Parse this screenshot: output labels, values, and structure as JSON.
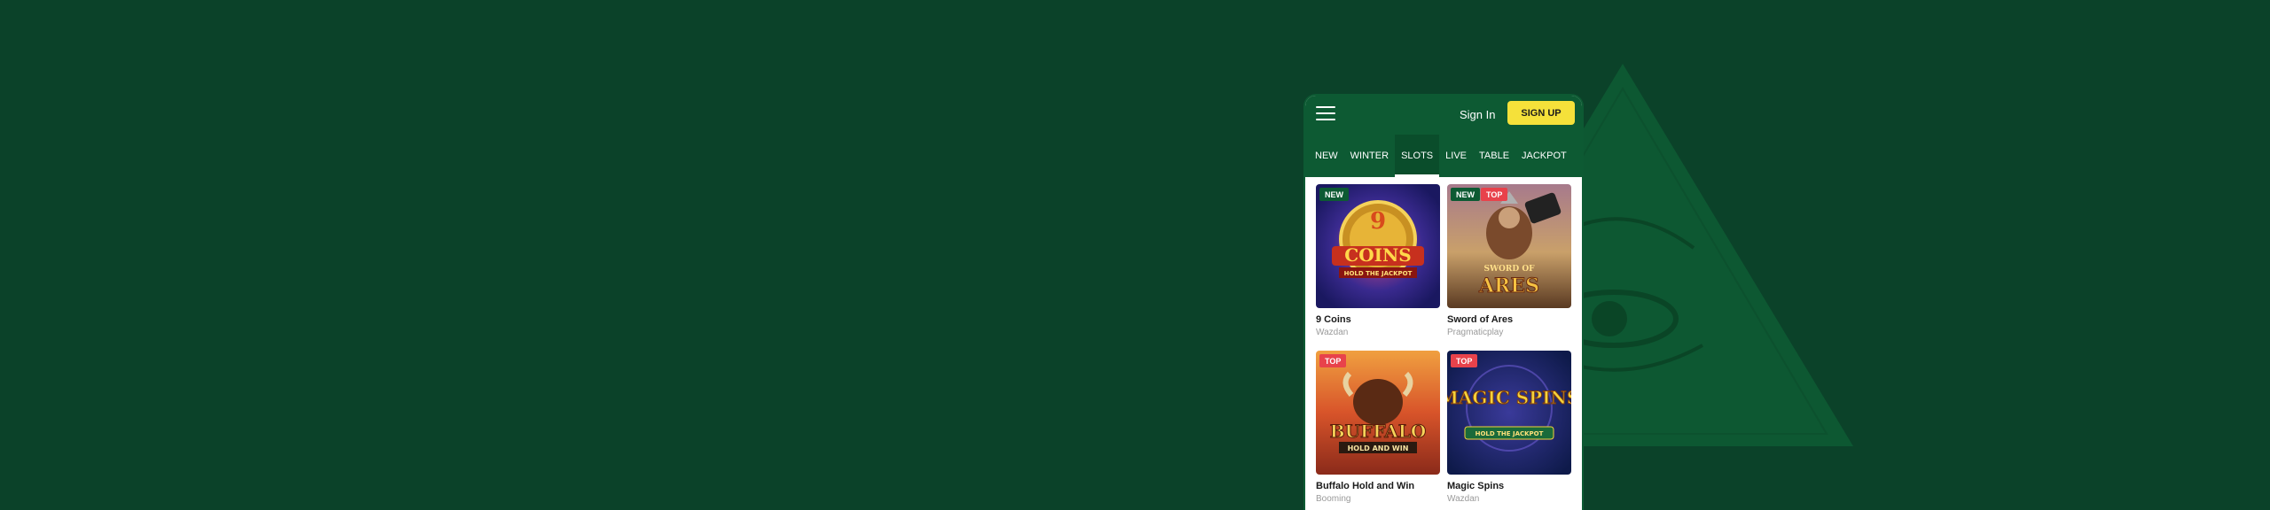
{
  "header": {
    "sign_in_label": "Sign In",
    "sign_up_label": "SIGN UP"
  },
  "tabs": [
    {
      "label": "NEW",
      "active": false
    },
    {
      "label": "WINTER",
      "active": false
    },
    {
      "label": "SLOTS",
      "active": true
    },
    {
      "label": "LIVE",
      "active": false
    },
    {
      "label": "TABLE",
      "active": false
    },
    {
      "label": "JACKPOT",
      "active": false
    }
  ],
  "games": [
    {
      "title": "9 Coins",
      "provider": "Wazdan",
      "badges": [
        "NEW"
      ],
      "art_title": "COINS",
      "art_subtitle": "HOLD THE JACKPOT"
    },
    {
      "title": "Sword of Ares",
      "provider": "Pragmaticplay",
      "badges": [
        "NEW",
        "TOP"
      ],
      "art_title": "ARES",
      "art_subtitle": "SWORD OF"
    },
    {
      "title": "Buffalo Hold and Win",
      "provider": "Booming",
      "badges": [
        "TOP"
      ],
      "art_title": "BUFFALO",
      "art_subtitle": "HOLD AND WIN"
    },
    {
      "title": "Magic Spins",
      "provider": "Wazdan",
      "badges": [
        "TOP"
      ],
      "art_title": "MAGIC SPINS",
      "art_subtitle": "HOLD THE JACKPOT"
    }
  ],
  "colors": {
    "background": "#0b4229",
    "header": "#0d5a33",
    "accent": "#f5e13a",
    "badge_new": "#0d5a33",
    "badge_top": "#e8424b"
  }
}
